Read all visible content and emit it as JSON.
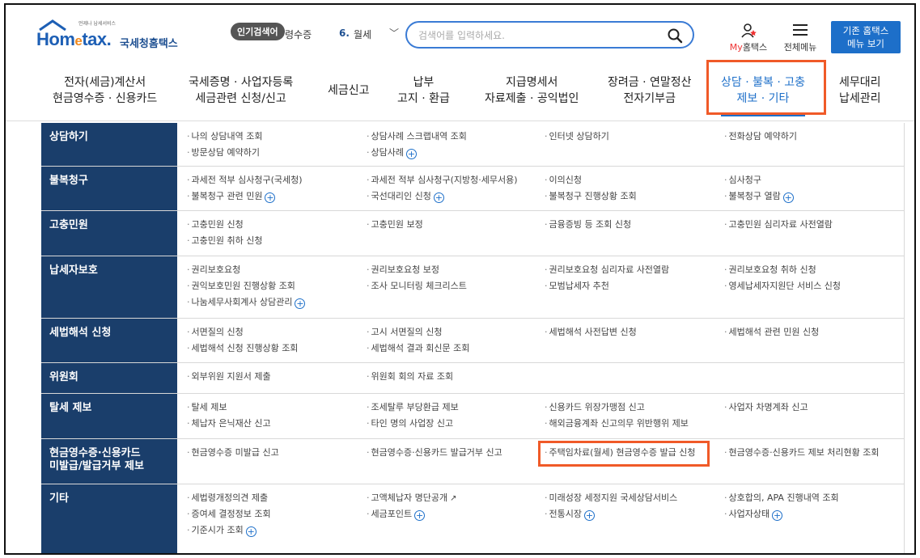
{
  "header": {
    "logo_tag": "언제나 납세서비스",
    "logo_word_pre": "Hom",
    "logo_word_e": "e",
    "logo_word_post": "tax.",
    "logo_korean": "국세청홈택스",
    "popular_badge": "인기검색어",
    "popular_prev_fragment": "령수증",
    "popular_rank": "6.",
    "popular_term": "월세",
    "search_placeholder": "검색어를 입력하세요.",
    "myhome_my": "My",
    "myhome_label": "홈택스",
    "allmenu_label": "전체메뉴",
    "oldsite_line1": "기존 홈택스",
    "oldsite_line2": "메뉴 보기"
  },
  "nav": [
    {
      "line1": "전자(세금)계산서",
      "line2": "현금영수증 · 신용카드"
    },
    {
      "line1": "국세증명 · 사업자등록",
      "line2": "세금관련 신청/신고"
    },
    {
      "line1": "세금신고",
      "line2": ""
    },
    {
      "line1": "납부",
      "line2": "고지 · 환급"
    },
    {
      "line1": "지급명세서",
      "line2": "자료제출 · 공익법인"
    },
    {
      "line1": "장려금 · 연말정산",
      "line2": "전자기부금"
    },
    {
      "line1": "상담 · 불복 · 고충",
      "line2": "제보 · 기타"
    },
    {
      "line1": "세무대리",
      "line2": "납세관리"
    }
  ],
  "menu": [
    {
      "category": "상담하기",
      "category2": "",
      "items": [
        "나의 상담내역 조회",
        "상담사례 스크랩내역 조회",
        "인터넷 상담하기",
        "전화상담 예약하기",
        "방문상담 예약하기",
        "상담사례",
        "",
        ""
      ]
    },
    {
      "category": "불복청구",
      "category2": "",
      "items": [
        "과세전 적부 심사청구(국세청)",
        "과세전 적부 심사청구(지방청·세무서용)",
        "이의신청",
        "심사청구",
        "불복청구 관련 민원",
        "국선대리인 신청",
        "불복청구 진행상황 조회",
        "불복청구 열람"
      ]
    },
    {
      "category": "고충민원",
      "category2": "",
      "items": [
        "고충민원 신청",
        "고충민원 보정",
        "금융증빙 등 조회 신청",
        "고충민원 심리자료 사전열람",
        "고충민원 취하 신청",
        "",
        "",
        ""
      ]
    },
    {
      "category": "납세자보호",
      "category2": "",
      "items": [
        "권리보호요청",
        "권리보호요청 보정",
        "권리보호요청 심리자료 사전열람",
        "권리보호요청 취하 신청",
        "권익보호민원 진행상황 조회",
        "조사 모니터링 체크리스트",
        "모범납세자 추천",
        "영세납세자지원단 서비스 신청",
        "나눔세무사회계사 상담관리",
        "",
        "",
        ""
      ]
    },
    {
      "category": "세법해석 신청",
      "category2": "",
      "items": [
        "서면질의 신청",
        "고시 서면질의 신청",
        "세법해석 사전답변 신청",
        "세법해석 관련 민원 신청",
        "세법해석 신청 진행상황 조회",
        "세법해석 결과 회신문 조회",
        "",
        ""
      ]
    },
    {
      "category": "위원회",
      "category2": "",
      "items": [
        "외부위원 지원서 제출",
        "위원회 회의 자료 조회",
        "",
        ""
      ]
    },
    {
      "category": "탈세 제보",
      "category2": "",
      "items": [
        "탈세 제보",
        "조세탈루 부당환급 제보",
        "신용카드 위장가맹점 신고",
        "사업자 차명계좌 신고",
        "체납자 은닉재산 신고",
        "타인 명의 사업장 신고",
        "해외금융계좌 신고의무 위반행위 제보",
        ""
      ]
    },
    {
      "category": "현금영수증·신용카드",
      "category2": "미발급/발급거부 제보",
      "items": [
        "현금영수증 미발급 신고",
        "현금영수증·신용카드 발급거부 신고",
        "주택임차료(월세) 현금영수증 발급 신청",
        "현금영수증·신용카드 제보 처리현황 조회"
      ]
    },
    {
      "category": "기타",
      "category2": "",
      "items": [
        "세법령개정의견 제출",
        "고액체납자 명단공개",
        "미래성장 세정지원 국세상담서비스",
        "상호합의, APA 진행내역 조회",
        "증여세 결정정보 조회",
        "세금포인트",
        "전통시장",
        "사업자상태",
        "기준시가 조회",
        "",
        "",
        ""
      ]
    }
  ],
  "colors": {
    "accent": "#1d6fc9",
    "sidebar": "#1a3e6b",
    "highlight": "#f05a28"
  }
}
